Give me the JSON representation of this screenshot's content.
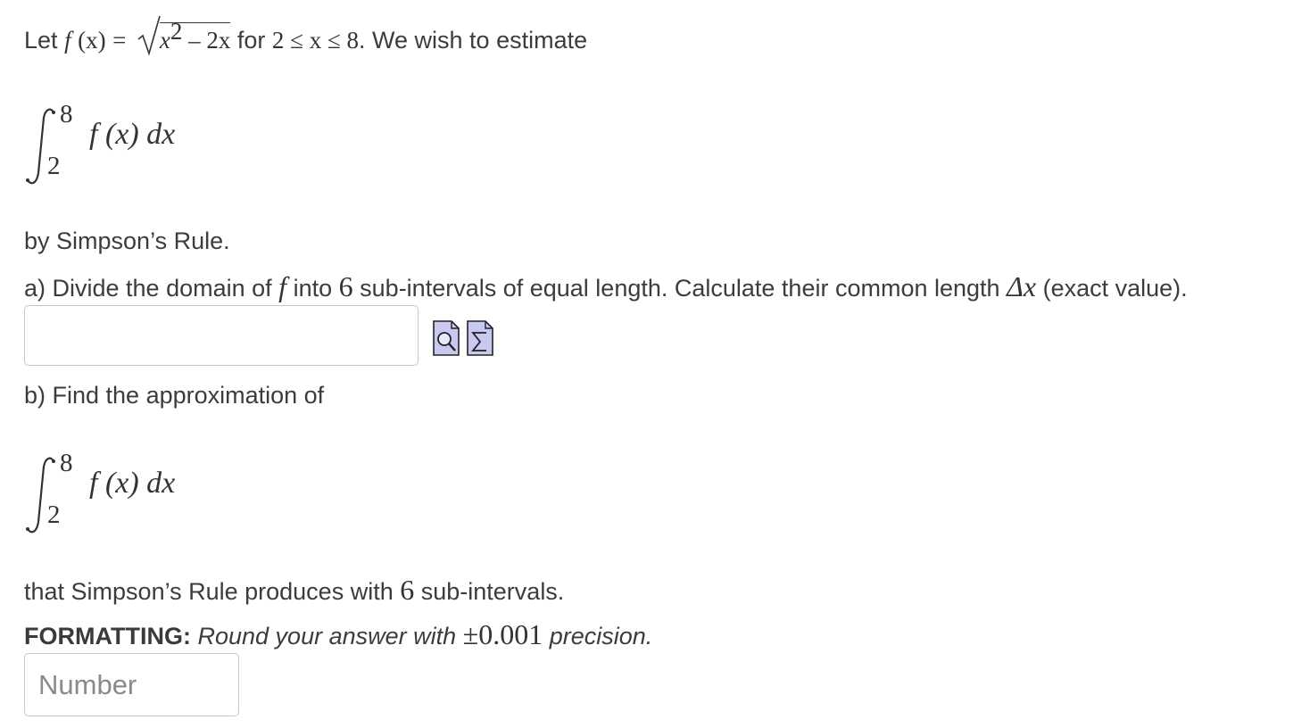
{
  "question": {
    "intro": {
      "let": "Let",
      "f": "f",
      "x_paren": "(x)",
      "equals": "=",
      "radicand_x": "x",
      "radicand_exp": "2",
      "radicand_rest": "– 2x",
      "for": "for",
      "range": "2  ≤  x  ≤  8",
      "tail": ". We wish to estimate"
    },
    "integral": {
      "upper": "8",
      "lower": "2",
      "integrand": "f  (x)  dx"
    },
    "by_rule": "by Simpson’s Rule.",
    "part_a": {
      "prefix": "a) Divide the domain of",
      "f": "f",
      "middle1": "into",
      "n": "6",
      "middle2": "sub-intervals of equal length. Calculate their common length",
      "delta": "Δx",
      "suffix": "(exact value)."
    },
    "part_a_answer": {
      "value": ""
    },
    "icons": {
      "preview": "preview-icon",
      "equation": "equation-editor-icon"
    },
    "part_b": {
      "prefix": "b) Find the approximation of"
    },
    "part_b_after": {
      "prefix": "that Simpson’s Rule produces with",
      "n": "6",
      "suffix": "sub-intervals."
    },
    "formatting": {
      "label": "FORMATTING:",
      "text1": "Round your answer with",
      "precision": "±0.001",
      "text2": "precision."
    },
    "part_b_answer": {
      "placeholder": "Number",
      "value": ""
    }
  }
}
